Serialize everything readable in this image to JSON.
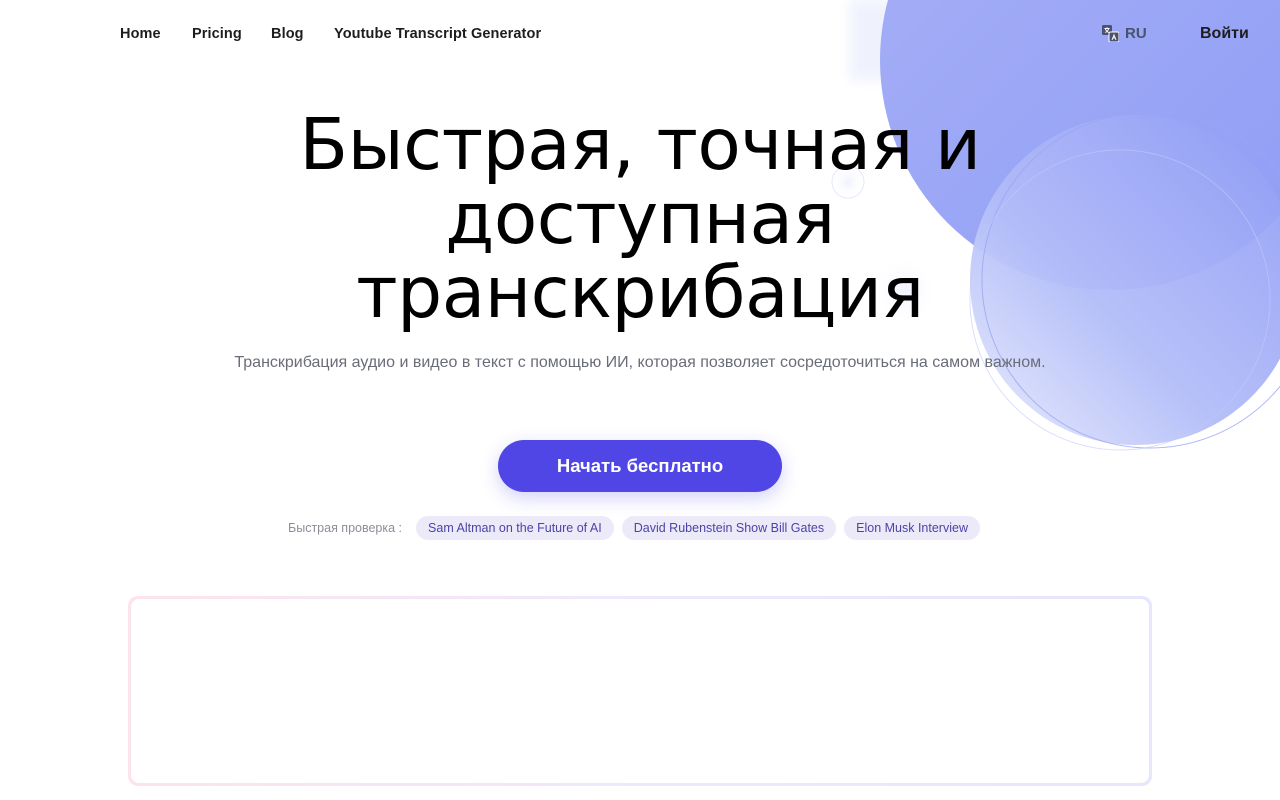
{
  "nav": {
    "items": [
      {
        "label": "Home"
      },
      {
        "label": "Pricing"
      },
      {
        "label": "Blog"
      },
      {
        "label": "Youtube Transcript Generator"
      }
    ],
    "language": {
      "code": "RU",
      "icon": "translate-icon"
    },
    "login_label": "Войти"
  },
  "hero": {
    "title": "Быстрая, точная и доступная транскрибация",
    "subtitle": "Транскрибация аудио и видео в текст с помощью ИИ, которая позволяет сосредоточиться на самом важном.",
    "cta_label": "Начать бесплатно"
  },
  "quick_check": {
    "label": "Быстрая проверка :",
    "chips": [
      {
        "label": "Sam Altman on the Future of AI"
      },
      {
        "label": "David Rubenstein Show Bill Gates"
      },
      {
        "label": "Elon Musk Interview"
      }
    ]
  },
  "colors": {
    "accent": "#4f46e5",
    "chip_bg": "#eceaf8",
    "chip_text": "#4b44a8",
    "blob": "#8f9cf5"
  }
}
